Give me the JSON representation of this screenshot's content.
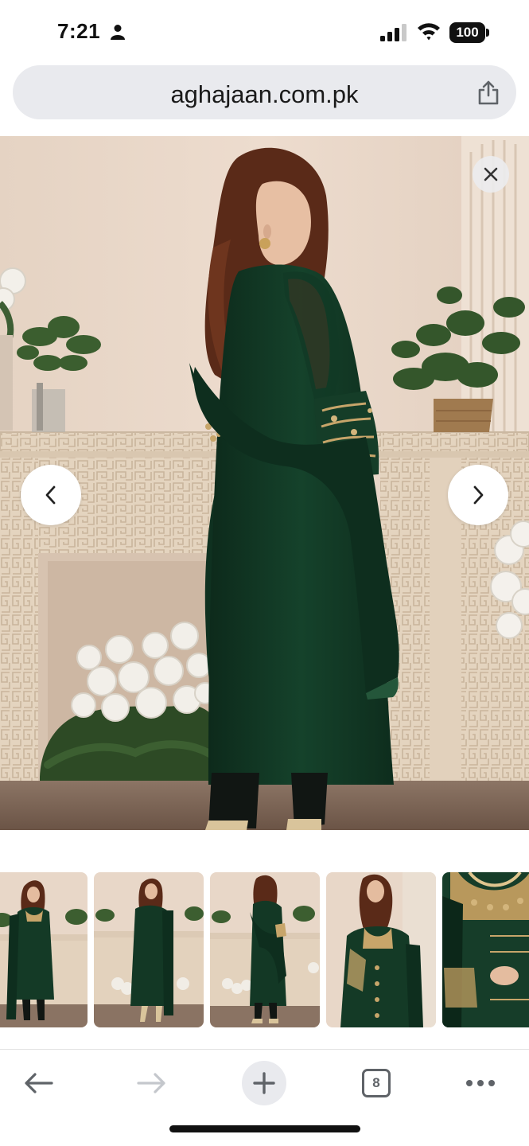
{
  "status_bar": {
    "time": "7:21",
    "battery": "100"
  },
  "browser": {
    "url": "aghajaan.com.pk",
    "tab_count": "8"
  },
  "gallery": {
    "current_image": 3,
    "thumbnail_count": 5
  },
  "icons": {
    "status": [
      "person-icon",
      "signal-icon",
      "wifi-icon",
      "battery-icon"
    ],
    "url_bar": [
      "share-icon"
    ],
    "gallery": [
      "close-icon",
      "chevron-left-icon",
      "chevron-right-icon"
    ],
    "toolbar": [
      "back-arrow-icon",
      "forward-arrow-icon",
      "plus-icon",
      "tabs-icon",
      "more-icon"
    ]
  },
  "colors": {
    "dress_green": "#123a26",
    "wall": "#e9d7c8",
    "fireplace": "#e6d6c1",
    "url_bar_bg": "#e9eaee",
    "toolbar_icon": "#5f6368"
  }
}
